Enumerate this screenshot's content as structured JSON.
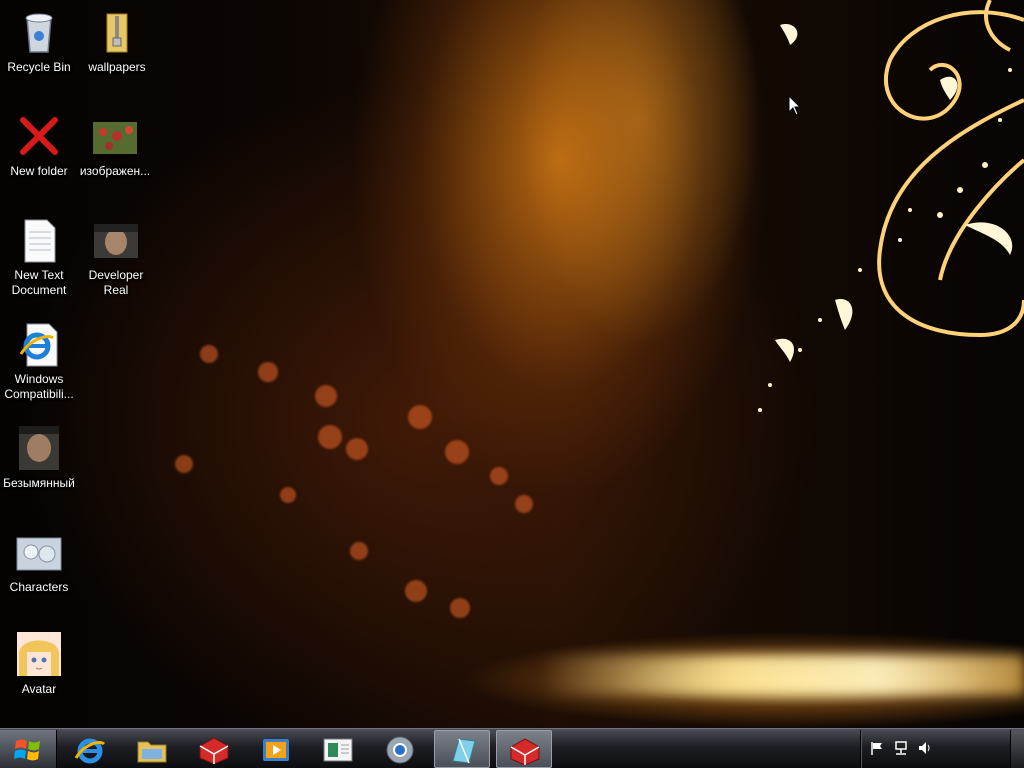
{
  "desktop": {
    "icons": [
      {
        "label": "Recycle Bin",
        "icon": "recycle-bin-icon"
      },
      {
        "label": "wallpapers",
        "icon": "zip-folder-icon"
      },
      {
        "label": "New folder",
        "icon": "red-x-icon"
      },
      {
        "label": "изображен...",
        "icon": "image-thumbnail-icon"
      },
      {
        "label": "New Text Document",
        "icon": "text-document-icon"
      },
      {
        "label": "Developer Real",
        "icon": "photo-thumbnail-icon"
      },
      {
        "label": "Windows Compatibili...",
        "icon": "internet-explorer-icon"
      },
      {
        "label": "Безымянный",
        "icon": "photo-thumbnail-icon"
      },
      {
        "label": "Characters",
        "icon": "image-thumbnail-icon"
      },
      {
        "label": "Avatar",
        "icon": "anime-avatar-icon"
      }
    ]
  },
  "taskbar": {
    "start_icon": "windows-start-icon",
    "pinned": [
      {
        "icon": "internet-explorer-icon",
        "active": false
      },
      {
        "icon": "file-explorer-icon",
        "active": false
      },
      {
        "icon": "red-box-app-icon",
        "active": false
      },
      {
        "icon": "media-player-icon",
        "active": false
      },
      {
        "icon": "notepad-window-icon",
        "active": false
      },
      {
        "icon": "chrome-icon",
        "active": false
      },
      {
        "icon": "blue-app-icon",
        "active": true
      },
      {
        "icon": "red-box-app-icon",
        "active": true
      }
    ],
    "tray": [
      "flag-icon",
      "network-icon",
      "volume-icon"
    ]
  },
  "colors": {
    "taskbar_top": "#4a4d55",
    "taskbar_bottom": "#0c0d10",
    "desktop_glow": "#ffb432"
  }
}
